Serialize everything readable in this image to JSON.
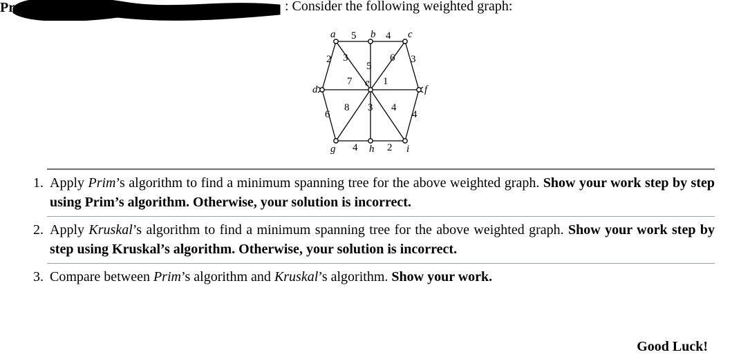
{
  "header": {
    "prefix_visible_fragment": "Pr",
    "intro_text": ": Consider the following weighted graph:"
  },
  "graph": {
    "vertex_labels": {
      "a": "a",
      "b": "b",
      "c": "c",
      "d": "d",
      "e": "e",
      "f": "f",
      "g": "g",
      "h": "h",
      "i": "i"
    },
    "edge_weights": {
      "ab": "5",
      "bc": "4",
      "ad": "2",
      "cf": "3",
      "dg": "6",
      "fi": "4",
      "gh": "4",
      "hi": "2",
      "ae": "3",
      "be": "5",
      "ce": "6",
      "de": "7",
      "ef": "1",
      "ge": "8",
      "eh": "3",
      "ei": "4"
    }
  },
  "questions": [
    {
      "before_algo": "Apply ",
      "algo": "Prim",
      "after_algo": "’s algorithm to find a minimum spanning tree for the above weighted graph. ",
      "bold": "Show your work step by step using Prim’s algorithm. Otherwise, your solution is incorrect."
    },
    {
      "before_algo": "Apply ",
      "algo": "Kruskal",
      "after_algo": "’s algorithm to find a minimum spanning tree for the above weighted graph. ",
      "bold": "Show your work step by step using Kruskal’s algorithm. Otherwise, your solution is incorrect."
    },
    {
      "before_algo": "Compare between ",
      "algo": "Prim",
      "mid": "’s algorithm and ",
      "algo2": "Kruskal",
      "after": "’s algorithm. ",
      "bold": "Show your work."
    }
  ],
  "footer": "Good Luck!"
}
